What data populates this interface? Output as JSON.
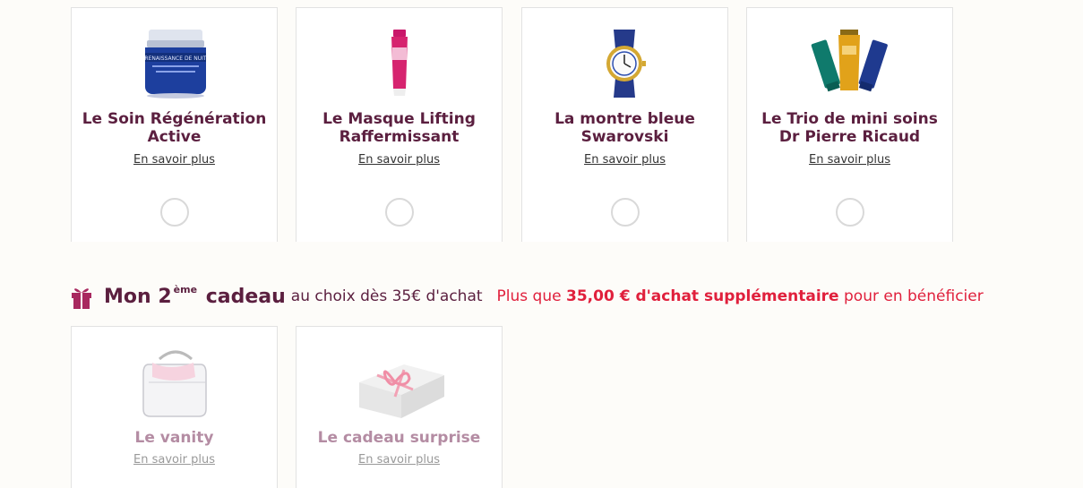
{
  "gifts_row1": [
    {
      "title": "Le Soin Régénération Active",
      "more": "En savoir plus",
      "image": "cream-jar",
      "image_label": "RENAISSANCE DE NUIT"
    },
    {
      "title": "Le Masque Lifting Raffermissant",
      "more": "En savoir plus",
      "image": "mask-tube"
    },
    {
      "title": "La montre bleue Swarovski",
      "more": "En savoir plus",
      "image": "blue-watch"
    },
    {
      "title": "Le Trio de mini soins Dr Pierre Ricaud",
      "more": "En savoir plus",
      "image": "mini-tubes-trio"
    }
  ],
  "second_gift": {
    "heading_main": "Mon 2",
    "heading_sup": "ème",
    "heading_word": "cadeau",
    "heading_sub": "au choix dès 35€ d'achat",
    "note_prefix": "Plus que",
    "note_amount": "35,00 € d'achat supplémentaire",
    "note_suffix": "pour en bénéficier",
    "icon": "gift-icon"
  },
  "gifts_row2": [
    {
      "title": "Le vanity",
      "more": "En savoir plus",
      "image": "vanity-bag"
    },
    {
      "title": "Le cadeau surprise",
      "more": "En savoir plus",
      "image": "gift-box"
    }
  ],
  "colors": {
    "title": "#5b1f3f",
    "title_disabled": "#b48ca3",
    "alert": "#e0203c",
    "icon": "#a8285f"
  }
}
